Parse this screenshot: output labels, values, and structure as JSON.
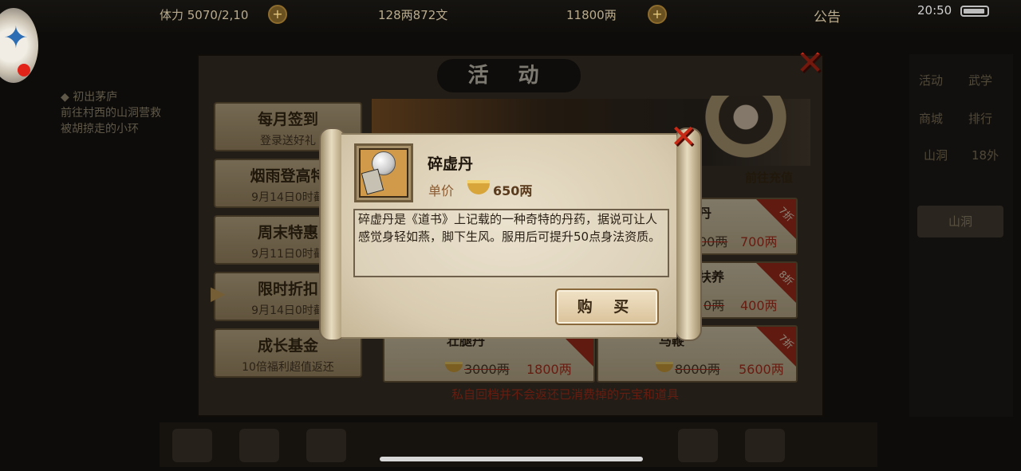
{
  "hud": {
    "stamina": "体力 5070/2,10",
    "silver": "128两872文",
    "gold": "11800两",
    "announcement": "公告",
    "clock": "20:50",
    "plus": "+"
  },
  "quest": {
    "title": "◆ 初出茅庐",
    "line1": "前往村西的山洞营救",
    "line2": "被胡掠走的小环"
  },
  "side_menu": {
    "activity": "活动",
    "martial": "武学",
    "shop": "商城",
    "rank": "排行",
    "mountain": "山洞",
    "expand": "18外",
    "box": "山洞"
  },
  "panel": {
    "title": "活 动",
    "close": "✕",
    "goto_recharge": "前往充值",
    "notice": "私自回档并不会返还已消费掉的元宝和道具"
  },
  "tabs": [
    {
      "name": "每月签到",
      "sub": "登录送好礼"
    },
    {
      "name": "烟雨登高特",
      "sub": "9月14日0时截"
    },
    {
      "name": "周末特惠",
      "sub": "9月11日0时截"
    },
    {
      "name": "限时折扣",
      "sub": "9月14日0时截"
    },
    {
      "name": "成长基金",
      "sub": "10倍福利超值返还"
    }
  ],
  "shop_items": [
    {
      "name": "丹",
      "old_price": "00两",
      "new_price": "700两",
      "discount": "7折"
    },
    {
      "name": "扶养",
      "old_price": "0两",
      "new_price": "400两",
      "discount": "8折"
    },
    {
      "name": "壮腿丹",
      "old_price": "3000两",
      "new_price": "1800两",
      "discount": ""
    },
    {
      "name": "马鞭",
      "old_price": "8000两",
      "new_price": "5600两",
      "discount": "7折"
    }
  ],
  "popup": {
    "item_name": "碎虚丹",
    "price_label": "单价",
    "price": "650两",
    "description": "碎虚丹是《道书》上记载的一种奇特的丹药，据说可让人感觉身轻如燕，脚下生风。服用后可提升50点身法资质。",
    "buy_label": "购 买",
    "close": "✕"
  },
  "colors": {
    "accent_red": "#b0321e",
    "paper": "#e0d4bb",
    "gold": "#d7a53a"
  },
  "icons": [
    "gold-ingot-icon",
    "pearl-pill-icon",
    "close-icon",
    "arrow-icon"
  ]
}
